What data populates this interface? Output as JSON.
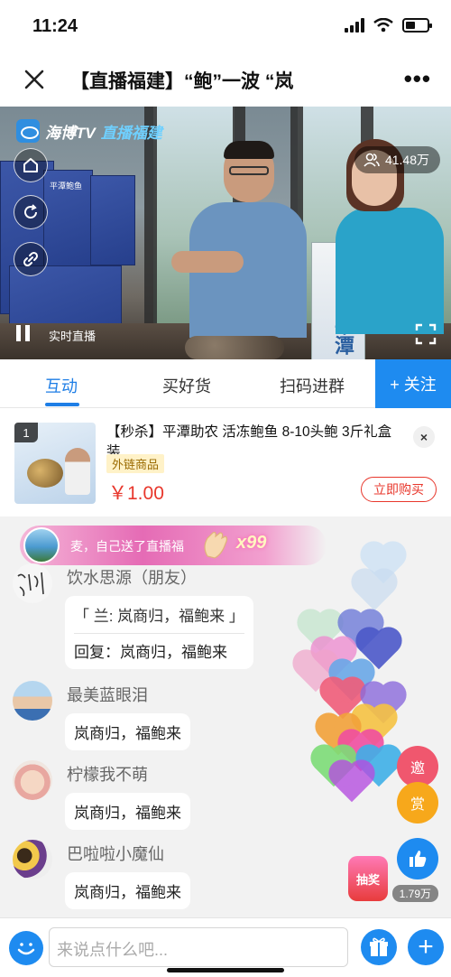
{
  "status_bar": {
    "time": "11:24"
  },
  "nav": {
    "title": "【直播福建】“鲍”一波 “岚"
  },
  "video": {
    "logo_brand": "海博TV",
    "logo_channel": "直播福建",
    "viewer_count": "41.48万",
    "live_label": "实时直播",
    "standee_text": "平潭"
  },
  "tabs": [
    {
      "label": "互动"
    },
    {
      "label": "买好货"
    },
    {
      "label": "扫码进群"
    }
  ],
  "follow_label": "+ 关注",
  "product": {
    "index": "1",
    "title": "【秒杀】平潭助农 活冻鲍鱼 8-10头鲍 3斤礼盒装",
    "tag": "外链商品",
    "price": "￥1.00",
    "buy_label": "立即购买",
    "close_label": "×"
  },
  "gift_banner": {
    "text": "麦，自己送了直播福",
    "count": "x99"
  },
  "messages": [
    {
      "name": "饮水思源（朋友）",
      "quote": "「 兰: 岚商归，福鲍来 」",
      "text": "回复：岚商归，福鲍来"
    },
    {
      "name": "最美蓝眼泪",
      "text": "岚商归，福鲍来"
    },
    {
      "name": "柠檬我不萌",
      "text": "岚商归，福鲍来"
    },
    {
      "name": "巴啦啦小魔仙",
      "text": "岚商归，福鲍来"
    }
  ],
  "side_actions": {
    "invite_label": "邀",
    "reward_label": "赏",
    "lottery_label": "抽奖",
    "like_count": "1.79万"
  },
  "input": {
    "placeholder": "来说点什么吧..."
  },
  "colors": {
    "accent": "#1e8bf0",
    "price": "#e8372c",
    "tab_active": "#1e7ee6"
  }
}
